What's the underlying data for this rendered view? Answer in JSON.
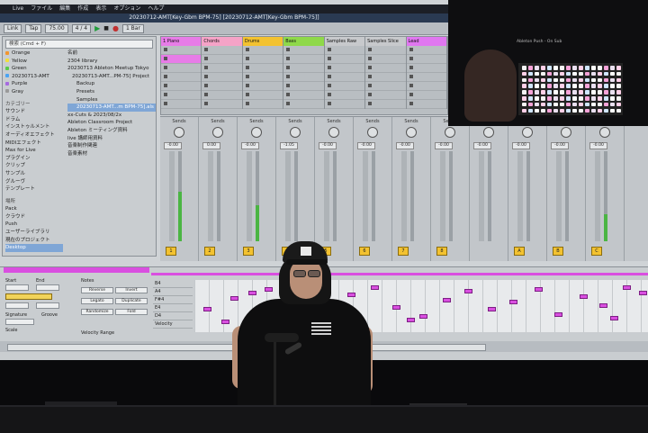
{
  "menu": [
    "Live",
    "ファイル",
    "編集",
    "作成",
    "表示",
    "オプション",
    "ヘルプ"
  ],
  "window_title": "20230712-AMT[Key-Gbm BPM-75] [20230712-AMT[Key-Gbm BPM-75]]",
  "toolbar": {
    "link": "Link",
    "tap": "Tap",
    "tempo": "75.00",
    "meter": "4 / 4",
    "quantize": "1 Bar"
  },
  "browser": {
    "search_placeholder": "検索 (Cmd + F)",
    "colors": [
      {
        "label": "Orange",
        "color": "#f29530"
      },
      {
        "label": "Yellow",
        "color": "#f1df3b"
      },
      {
        "label": "Green",
        "color": "#5ac94a"
      },
      {
        "label": "20230713-AMT",
        "color": "#4aa3f2"
      },
      {
        "label": "Purple",
        "color": "#a66ae0"
      },
      {
        "label": "Gray",
        "color": "#9a9a9a"
      }
    ],
    "categories_header": "カテゴリー",
    "categories": [
      "サウンド",
      "ドラム",
      "インストゥルメント",
      "オーディオエフェクト",
      "MIDIエフェクト",
      "Max for Live",
      "プラグイン",
      "クリップ",
      "サンプル",
      "グルーヴ",
      "テンプレート"
    ],
    "places_header": "場所",
    "places": [
      "Pack",
      "クラウド",
      "Push",
      "ユーザーライブラリ",
      "現在のプロジェクト",
      "Desktop"
    ],
    "name_header": "名前",
    "files": [
      "2304 library",
      "20230713 Ableton Meetup Tokyo",
      "20230713-AMT...PM-75] Project",
      "Backup",
      "Presets",
      "Samples",
      "20230713-AMT...m BPM-75].als",
      "xx-Cuts & 2023/08/2x",
      "Ableton Classroom Project",
      "Ableton ミーティング資料",
      "live 講師用資料",
      "音楽制作関連",
      "音楽素材"
    ]
  },
  "tracks": [
    {
      "name": "1 Piano",
      "color": "#e77ce7"
    },
    {
      "name": "Chords",
      "color": "#f5a3c7"
    },
    {
      "name": "Drums",
      "color": "#f3c230"
    },
    {
      "name": "Bass",
      "color": "#8fd94a"
    },
    {
      "name": "Samples Raw",
      "color": "#c7c9cc"
    },
    {
      "name": "Samples Slice",
      "color": "#c7c9cc"
    },
    {
      "name": "Lead",
      "color": "#e077f0"
    }
  ],
  "mixer": {
    "sends_label": "Sends",
    "volumes": [
      "-0.00",
      "0.00",
      "-0.00",
      "-1.05",
      "-0.00",
      "-0.00",
      "-0.00",
      "-0.00",
      "-0.00",
      "-0.00",
      "-0.00",
      "-0.00"
    ],
    "track_numbers": [
      "1",
      "2",
      "3",
      "4",
      "5",
      "6",
      "7",
      "8",
      "",
      "A",
      "B",
      "C"
    ],
    "meter_levels": [
      0.55,
      0.0,
      0.4,
      0.0,
      0.0,
      0.0,
      0.0,
      0.0,
      0.0,
      0.0,
      0.0,
      0.3
    ]
  },
  "video": {
    "caption": "Ableton Push - On Sub"
  },
  "clip_editor": {
    "start_label": "Start",
    "end_label": "End",
    "signature_label": "Signature",
    "groove_label": "Groove",
    "scale_label": "Scale",
    "notes_label": "Notes",
    "velocity_label": "Velocity Range",
    "keys": [
      "B4",
      "A4",
      "F#4",
      "E4",
      "D4",
      "Velocity"
    ],
    "buttons": [
      "Reverse",
      "Invert",
      "Legato",
      "Duplicate",
      "Randomize",
      "Fold"
    ]
  }
}
